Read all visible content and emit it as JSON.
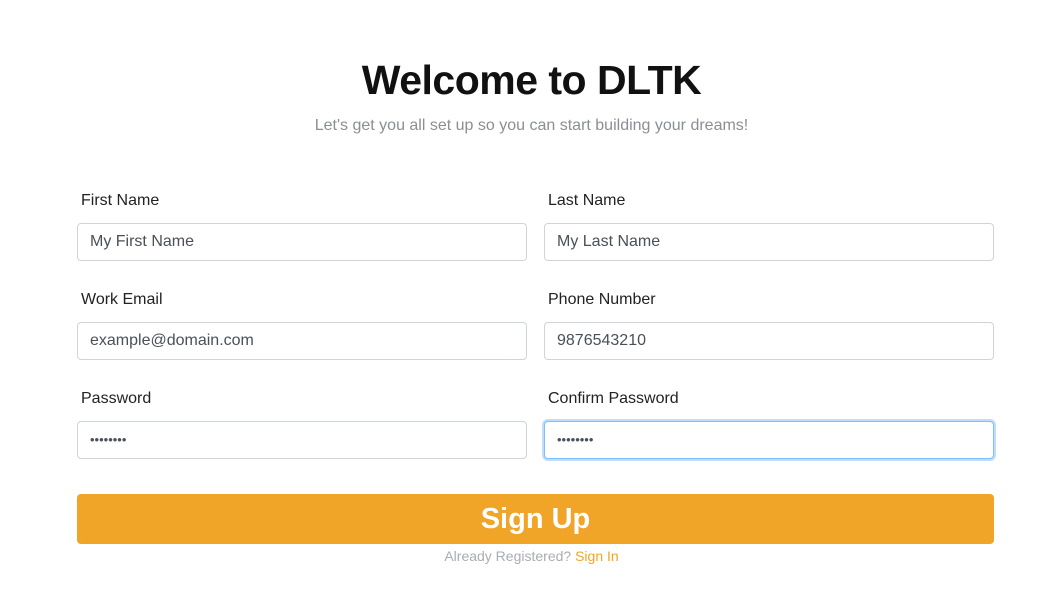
{
  "header": {
    "title": "Welcome to DLTK",
    "subtitle": "Let's get you all set up so you can start building your dreams!"
  },
  "form": {
    "first_name": {
      "label": "First Name",
      "placeholder": "My First Name"
    },
    "last_name": {
      "label": "Last Name",
      "placeholder": "My Last Name"
    },
    "work_email": {
      "label": "Work Email",
      "placeholder": "example@domain.com"
    },
    "phone_number": {
      "label": "Phone Number",
      "placeholder": "9876543210"
    },
    "password": {
      "label": "Password",
      "masked_value": "••••••••"
    },
    "confirm_password": {
      "label": "Confirm Password",
      "masked_value": "••••••••"
    }
  },
  "actions": {
    "signup_label": "Sign Up",
    "already_registered_text": "Already Registered?",
    "signin_label": "Sign In"
  },
  "colors": {
    "accent": "#f0a428",
    "focus_border": "#80bdff"
  }
}
